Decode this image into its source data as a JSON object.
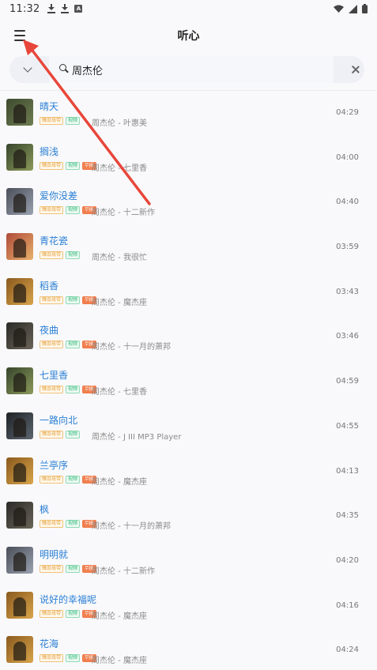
{
  "status": {
    "time": "11:32"
  },
  "header": {
    "title": "听心"
  },
  "search": {
    "value": "周杰伦",
    "placeholder": ""
  },
  "tags": {
    "quality": "臻品母带",
    "mv": "视频",
    "sq": "무损"
  },
  "songs": [
    {
      "title": "晴天",
      "subtitle": "周杰伦 - 叶惠美",
      "duration": "04:29",
      "sq": false,
      "cover": [
        "#3d4a2e",
        "#6f7d52"
      ]
    },
    {
      "title": "搁浅",
      "subtitle": "周杰伦 - 七里香",
      "duration": "04:00",
      "sq": true,
      "cover": [
        "#36452b",
        "#8c9a5a"
      ]
    },
    {
      "title": "爱你没差",
      "subtitle": "周杰伦 - 十二新作",
      "duration": "04:40",
      "sq": true,
      "cover": [
        "#4a4e58",
        "#9aa2b0"
      ]
    },
    {
      "title": "青花瓷",
      "subtitle": "周杰伦 - 我很忙",
      "duration": "03:59",
      "sq": false,
      "cover": [
        "#b04a3a",
        "#e7b16a"
      ]
    },
    {
      "title": "稻香",
      "subtitle": "周杰伦 - 魔杰座",
      "duration": "03:43",
      "sq": true,
      "cover": [
        "#8a5a1e",
        "#d9a44a"
      ]
    },
    {
      "title": "夜曲",
      "subtitle": "周杰伦 - 十一月的萧邦",
      "duration": "03:46",
      "sq": true,
      "cover": [
        "#2b2a28",
        "#6a6458"
      ]
    },
    {
      "title": "七里香",
      "subtitle": "周杰伦 - 七里香",
      "duration": "04:59",
      "sq": true,
      "cover": [
        "#36452b",
        "#8c9a5a"
      ]
    },
    {
      "title": "一路向北",
      "subtitle": "周杰伦 - J III MP3 Player",
      "duration": "04:55",
      "sq": false,
      "cover": [
        "#1e2226",
        "#5c6670"
      ]
    },
    {
      "title": "兰亭序",
      "subtitle": "周杰伦 - 魔杰座",
      "duration": "04:13",
      "sq": true,
      "cover": [
        "#8a5a1e",
        "#d9a44a"
      ]
    },
    {
      "title": "枫",
      "subtitle": "周杰伦 - 十一月的萧邦",
      "duration": "04:35",
      "sq": true,
      "cover": [
        "#2b2a28",
        "#6a6458"
      ]
    },
    {
      "title": "明明就",
      "subtitle": "周杰伦 - 十二新作",
      "duration": "04:20",
      "sq": true,
      "cover": [
        "#4a4e58",
        "#9aa2b0"
      ]
    },
    {
      "title": "说好的幸福呢",
      "subtitle": "周杰伦 - 魔杰座",
      "duration": "04:16",
      "sq": true,
      "cover": [
        "#8a5a1e",
        "#d9a44a"
      ]
    },
    {
      "title": "花海",
      "subtitle": "周杰伦 - 魔杰座",
      "duration": "04:24",
      "sq": true,
      "cover": [
        "#8a5a1e",
        "#d9a44a"
      ]
    }
  ],
  "colors": {
    "accent": "#2a7fd4",
    "annotation": "#e8463a"
  }
}
